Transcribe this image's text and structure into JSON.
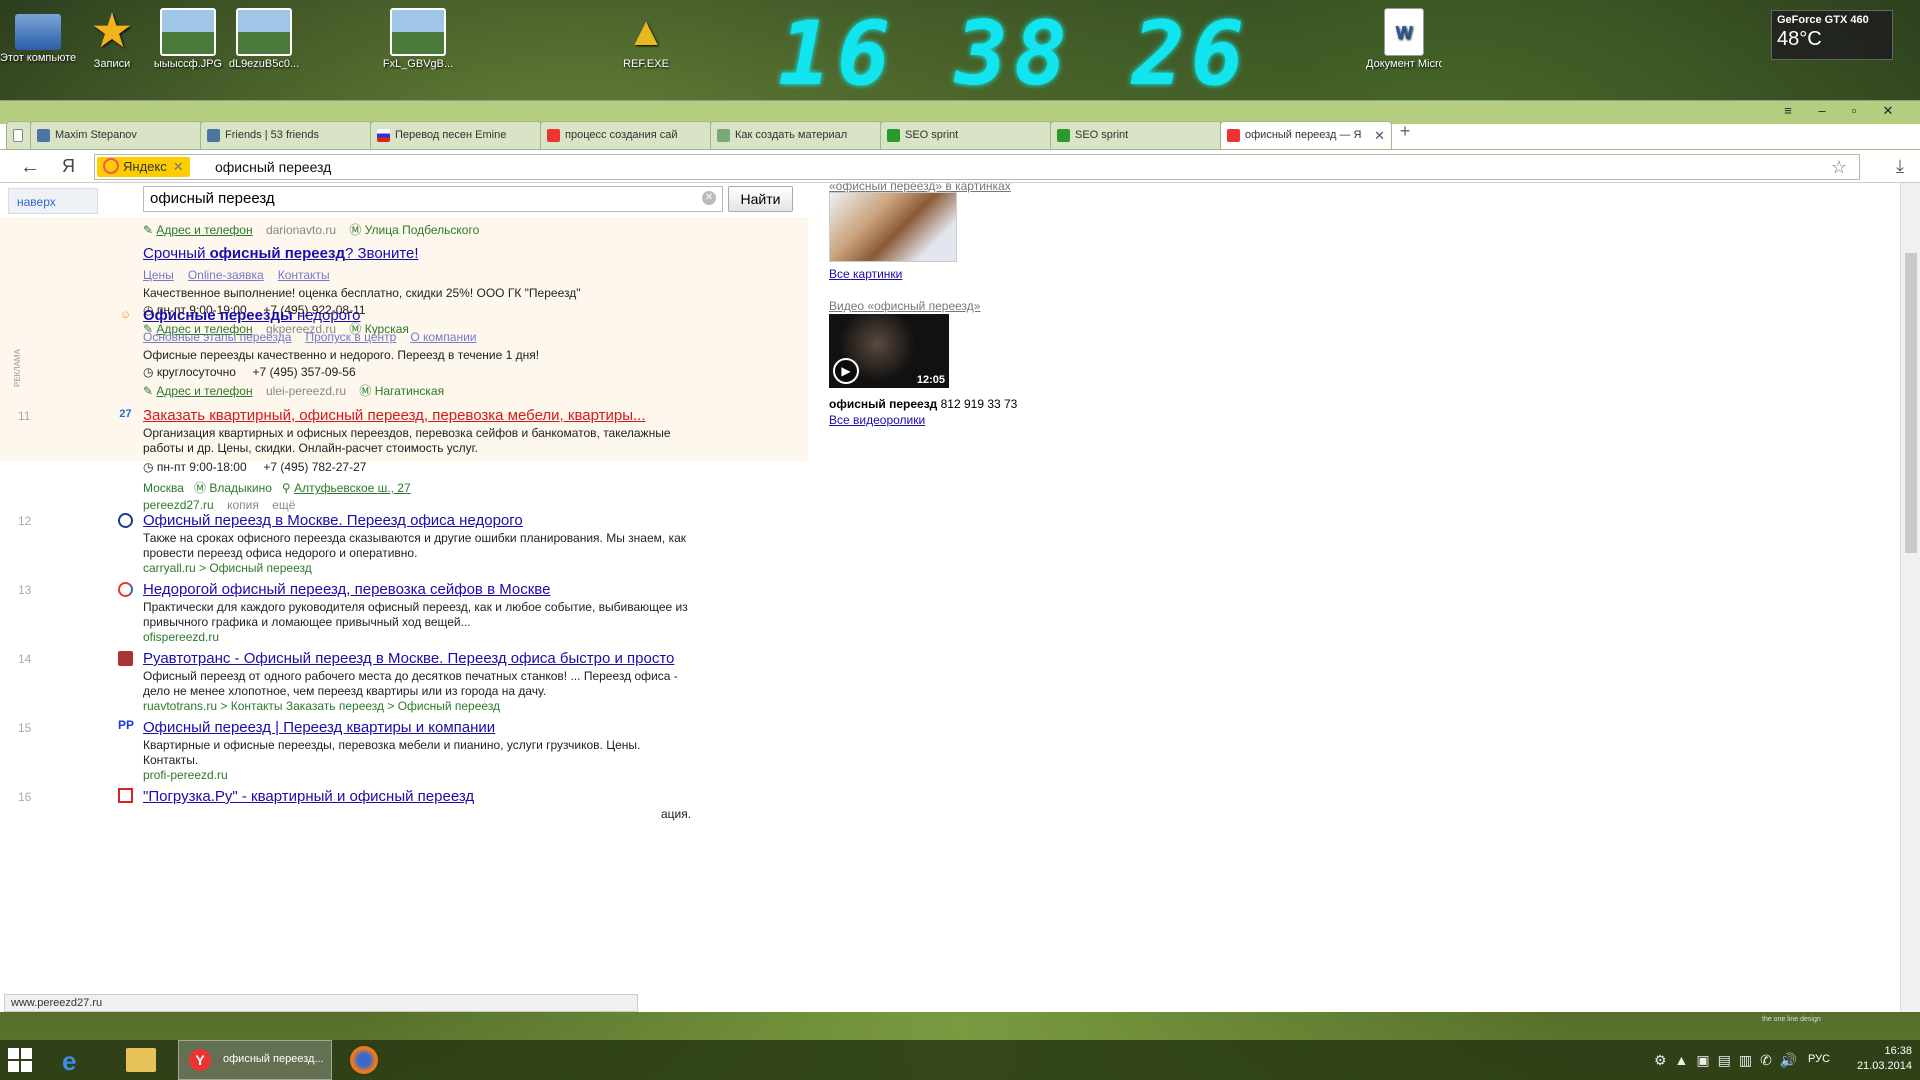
{
  "desktop": {
    "icons": [
      "Этот компьютер",
      "Записи",
      "ыыысcф.JPG",
      "dL9ezuB5c0...",
      "FxL_GBVgB...",
      "REF.EXE",
      "Документ Microsof..."
    ],
    "clock": "16 38 26",
    "gpu_name": "GeForce GTX 460",
    "gpu_temp": "48°C"
  },
  "browser": {
    "tabs": [
      {
        "label": "Maxim Stepanov"
      },
      {
        "label": "Friends | 53 friends"
      },
      {
        "label": "Перевод песен Emine"
      },
      {
        "label": "процесс создания сай"
      },
      {
        "label": "Как создать материал"
      },
      {
        "label": "SEO sprint"
      },
      {
        "label": "SEO sprint"
      },
      {
        "label": "офисный переезд — Я"
      }
    ],
    "yandex_badge": "Яндекс",
    "url_query": "офисный переезд",
    "status_url": "www.pereezd27.ru"
  },
  "search": {
    "to_top": "наверх",
    "query": "офисный переезд",
    "button": "Найти",
    "ad_label": "РЕКЛАМА"
  },
  "ads": [
    {
      "addr_link": "Адрес и телефон",
      "domain": "darionavto.ru",
      "metro": "Улица Подбельского"
    },
    {
      "title_pre": "Срочный ",
      "title_bold": "офисный переезд",
      "title_post": "? Звоните!",
      "sitelinks": [
        "Цены",
        "Online-заявка",
        "Контакты"
      ],
      "snippet": "Качественное выполнение! оценка бесплатно, скидки 25%! ООО ГК \"Переезд\"",
      "hours": "пн-пт 9:00-19:00",
      "phone": "+7 (495) 922-08-11",
      "addr_link": "Адрес и телефон",
      "domain": "gkpereezd.ru",
      "metro": "Курская"
    },
    {
      "title_bold": "Офисные переезды",
      "title_post": " недорого",
      "sitelinks": [
        "Основные этапы переезда",
        "Пропуск в центр",
        "О компании"
      ],
      "snippet": "Офисные переезды качественно и недорого. Переезд в течение 1 дня!",
      "hours": "круглосуточно",
      "phone": "+7 (495) 357-09-56",
      "addr_link": "Адрес и телефон",
      "domain": "ulei-pereezd.ru",
      "metro": "Нагатинская"
    }
  ],
  "results": [
    {
      "num": "11",
      "fav": "27",
      "title": "Заказать квартирный, офисный переезд, перевозка мебели, квартиры...",
      "lines": [
        "Организация квартирных и офисных переездов, перевозка сейфов и банкоматов, такелажные",
        "работы и др. Цены, скидки. Онлайн-расчет стоимость услуг."
      ],
      "hours": "пн-пт 9:00-18:00",
      "phone": "+7 (495) 782-27-27",
      "city": "Москва",
      "metro": "Владыкино",
      "address": "Алтуфьевское ш., 27",
      "domain": "pereezd27.ru",
      "copy": "копия",
      "more": "ещё"
    },
    {
      "num": "12",
      "title": "Офисный переезд в Москве. Переезд офиса недорого",
      "lines": [
        "Также на сроках офисного переезда сказываются и другие ошибки планирования. Мы знаем, как",
        "провести переезд офиса недорого и оперативно."
      ],
      "domain": "carryall.ru > Офисный переезд"
    },
    {
      "num": "13",
      "title": "Недорогой офисный переезд, перевозка сейфов в Москве",
      "lines": [
        "Практически для каждого руководителя офисный переезд, как и любое событие, выбивающее из",
        "привычного графика и ломающее привычный ход вещей..."
      ],
      "domain": "ofispereezd.ru"
    },
    {
      "num": "14",
      "title": "Руавтотранс - Офисный переезд в Москве. Переезд офиса быстро и просто",
      "lines": [
        "Офисный переезд от одного рабочего места до десятков печатных станков! ... Переезд офиса -",
        "дело не менее хлопотное, чем переезд квартиры или из города на дачу."
      ],
      "domain": "ruavtotrans.ru > Контакты Заказать переезд > Офисный переезд"
    },
    {
      "num": "15",
      "fav": "PP",
      "title": "Офисный переезд | Переезд квартиры и компании",
      "lines": [
        "Квартирные и офисные переезды, перевозка мебели и пианино, услуги грузчиков. Цены.",
        "Контакты."
      ],
      "domain": "profi-pereezd.ru"
    },
    {
      "num": "16",
      "title": "\"Погрузка.Ру\" - квартирный и офисный переезд",
      "lines": [
        "ация."
      ],
      "domain": ""
    }
  ],
  "right": {
    "images_header": "«офисный переезд» в картинках",
    "all_images": "Все картинки",
    "video_header": "Видео «офисный переезд»",
    "duration": "12:05",
    "video_title_bold": "офисный переезд",
    "video_title_rest": " 812 919 33 73",
    "all_videos": "Все видеоролики"
  },
  "taskbar": {
    "yandex_task": "офисный переезд...",
    "lang": "РУС",
    "time": "16:38",
    "date": "21.03.2014",
    "wallpaper_credit": "the one line design"
  }
}
